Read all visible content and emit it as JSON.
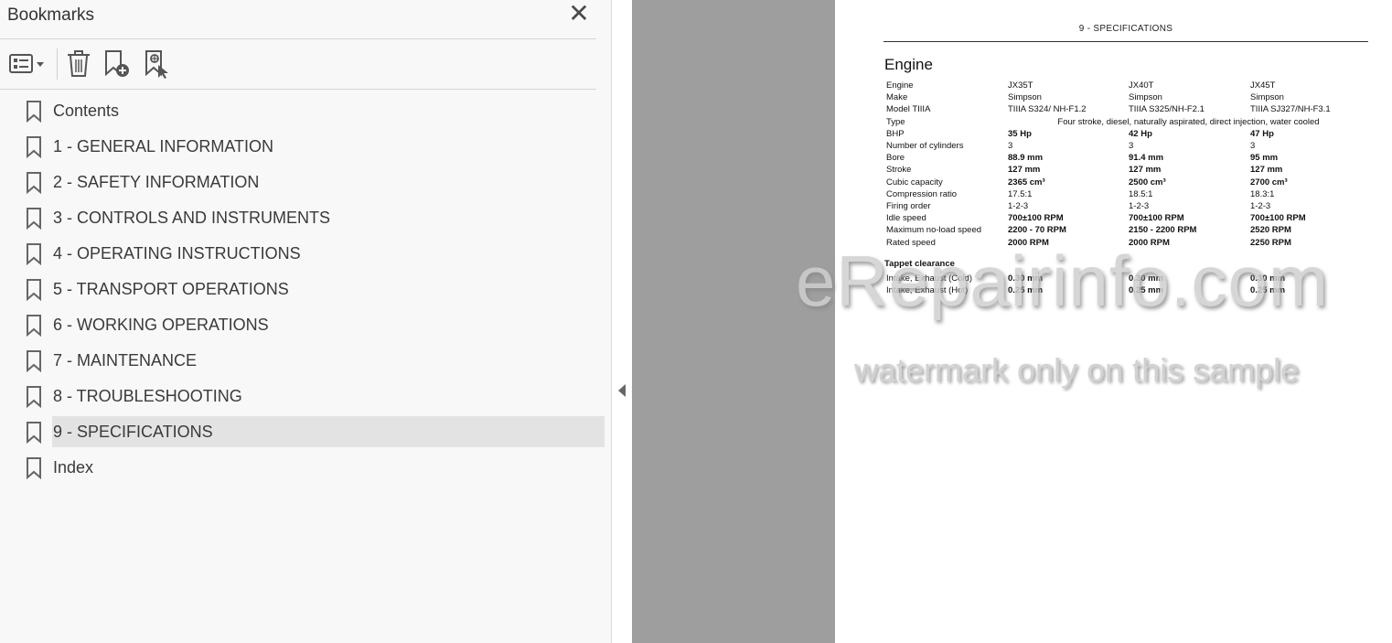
{
  "bookmarks_panel": {
    "title": "Bookmarks",
    "close_label": "✕",
    "toolbar": {
      "options_icon": "list-options-icon",
      "delete_icon": "trash-icon",
      "new_bookmark_icon": "bookmark-add-icon",
      "find_bookmark_icon": "bookmark-search-icon"
    },
    "items": [
      {
        "label": "Contents"
      },
      {
        "label": "1 - GENERAL INFORMATION"
      },
      {
        "label": "2 - SAFETY INFORMATION"
      },
      {
        "label": "3 - CONTROLS AND INSTRUMENTS"
      },
      {
        "label": "4 - OPERATING INSTRUCTIONS"
      },
      {
        "label": "5 - TRANSPORT OPERATIONS"
      },
      {
        "label": "6 - WORKING OPERATIONS"
      },
      {
        "label": "7 - MAINTENANCE"
      },
      {
        "label": "8 - TROUBLESHOOTING"
      },
      {
        "label": "9 - SPECIFICATIONS",
        "selected": true
      },
      {
        "label": "Index"
      }
    ]
  },
  "document": {
    "heading": "9 - SPECIFICATIONS",
    "section_title": "Engine",
    "spec_rows": [
      {
        "label": "Engine",
        "v1": "JX35T",
        "v2": "JX40T",
        "v3": "JX45T",
        "bold": false
      },
      {
        "label": "Make",
        "v1": "Simpson",
        "v2": "Simpson",
        "v3": "Simpson",
        "bold": false
      },
      {
        "label": "Model TIIIA",
        "v1": "TIIIA S324/ NH-F1.2",
        "v2": "TIIIA S325/NH-F2.1",
        "v3": "TIIIA SJ327/NH-F3.1",
        "bold": false
      },
      {
        "label": "Type",
        "span": "Four stroke, diesel, naturally aspirated, direct injection, water cooled"
      },
      {
        "label": "BHP",
        "v1": "35 Hp",
        "v2": "42 Hp",
        "v3": "47 Hp",
        "bold": true
      },
      {
        "label": "Number of cylinders",
        "v1": "3",
        "v2": "3",
        "v3": "3",
        "bold": false
      },
      {
        "label": "Bore",
        "v1": "88.9 mm",
        "v2": "91.4 mm",
        "v3": "95 mm",
        "bold": true
      },
      {
        "label": "Stroke",
        "v1": "127 mm",
        "v2": "127 mm",
        "v3": "127 mm",
        "bold": true
      },
      {
        "label": "Cubic capacity",
        "v1": "2365 cm³",
        "v2": "2500 cm³",
        "v3": "2700 cm³",
        "bold": true
      },
      {
        "label": "Compression ratio",
        "v1": "17.5:1",
        "v2": "18.5:1",
        "v3": "18.3:1",
        "bold": false
      },
      {
        "label": "Firing order",
        "v1": "1-2-3",
        "v2": "1-2-3",
        "v3": "1-2-3",
        "bold": false
      },
      {
        "label": "Idle speed",
        "v1": "700±100 RPM",
        "v2": "700±100 RPM",
        "v3": "700±100 RPM",
        "bold": true
      },
      {
        "label": "Maximum no-load speed",
        "v1": "2200 - 70 RPM",
        "v2": "2150 - 2200 RPM",
        "v3": "2520 RPM",
        "bold": true
      },
      {
        "label": "Rated speed",
        "v1": "2000 RPM",
        "v2": "2000 RPM",
        "v3": "2250 RPM",
        "bold": true
      }
    ],
    "tappet_title": "Tappet clearance",
    "tappet_rows": [
      {
        "label": "Intake, Exhaust (Cold)",
        "v1": "0.30 mm",
        "v2": "0.30 mm",
        "v3": "0.30 mm",
        "bold": true
      },
      {
        "label": "Intake, Exhaust (Hot)",
        "v1": "0.25 mm",
        "v2": "0.25 mm",
        "v3": "0.25 mm",
        "bold": true
      }
    ]
  },
  "watermark": {
    "main": "eRepairinfo.com",
    "sub": "watermark only on this sample"
  }
}
